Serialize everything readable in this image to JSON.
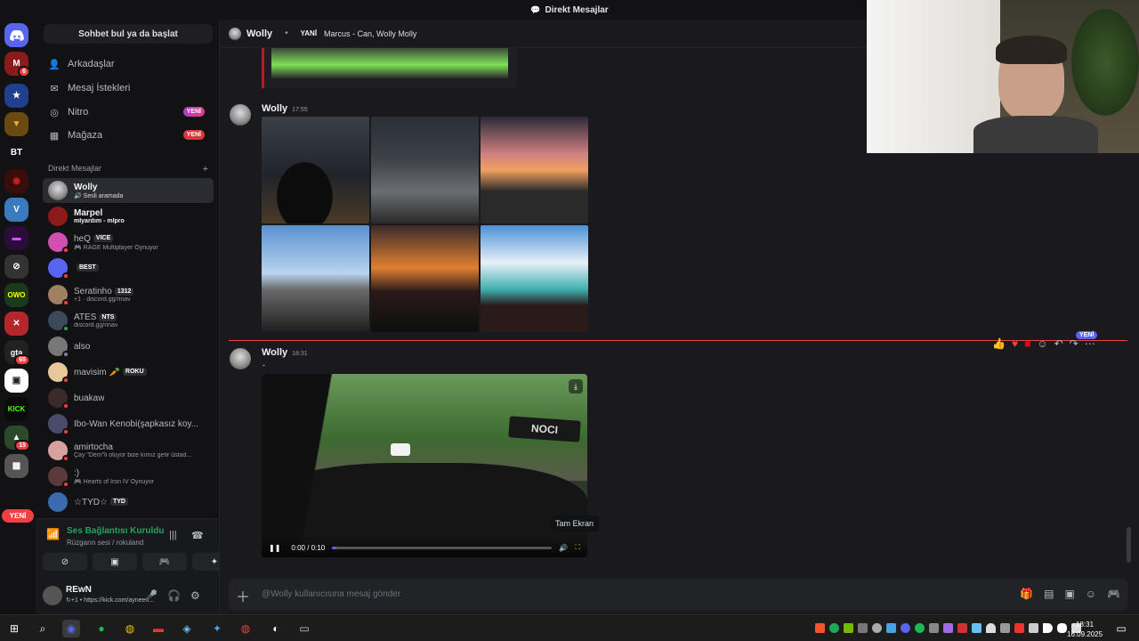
{
  "window": {
    "title": "Direkt Mesajlar"
  },
  "sidebar": {
    "search": "Sohbet bul ya da başlat",
    "nav": [
      {
        "label": "Arkadaşlar",
        "badge": ""
      },
      {
        "label": "Mesaj İstekleri",
        "badge": ""
      },
      {
        "label": "Nitro",
        "badge": "YENİ"
      },
      {
        "label": "Mağaza",
        "badge": "YENİ"
      }
    ],
    "dm_header": "Direkt Mesajlar",
    "dm_add": "+",
    "dms": [
      {
        "name": "Wolly",
        "sub": "Sesli aramada",
        "tag": ""
      },
      {
        "name": "Marpel",
        "sub": "mİyardım - mİpro",
        "tag": ""
      },
      {
        "name": "heQ",
        "sub": "RAGE Multiplayer Oynuyor",
        "tag": "VICE"
      },
      {
        "name": "",
        "sub": "",
        "tag": "BEST"
      },
      {
        "name": "Seratinho",
        "sub": "+1 · discord.gg/rinav",
        "tag": "1312"
      },
      {
        "name": "ATES",
        "sub": "discord.gg/rinav",
        "tag": "NTS"
      },
      {
        "name": "also",
        "sub": "",
        "tag": ""
      },
      {
        "name": "mavisim 🥕",
        "sub": "",
        "tag": "ROKU"
      },
      {
        "name": "buakaw",
        "sub": "",
        "tag": ""
      },
      {
        "name": "Ibo-Wan Kenobi(şapkasız koy...",
        "sub": "",
        "tag": ""
      },
      {
        "name": "amirtocha",
        "sub": "Çay \"Dem\"li oluyor bize kımız getir üstad...",
        "tag": ""
      },
      {
        "name": ":)",
        "sub": "Hearts of Iron IV Oynuyor",
        "tag": ""
      },
      {
        "name": "☆TYD☆",
        "sub": "",
        "tag": "TYD"
      }
    ]
  },
  "servers": {
    "items": [
      "M",
      "★",
      "▼",
      "BT",
      "◉",
      "V",
      "▬",
      "◯",
      "OWO",
      "✕",
      "gta",
      "▣",
      "KICK",
      "▲",
      "▦"
    ],
    "badges": {
      "m": "6",
      "gta": "65",
      "kick": "15"
    },
    "new_label": "YENİ"
  },
  "voice": {
    "title": "Ses Bağlantısı Kuruldu",
    "subtitle": "Rüzgarın sesi / rokuland"
  },
  "user": {
    "name": "REwN",
    "status": "↻+1 • https://kick.com/ayneen..."
  },
  "channel": {
    "name": "Wolly",
    "group_label": "YANİ",
    "group_members": "Marcus - Can, Wolly Molly"
  },
  "messages": [
    {
      "author": "Wolly",
      "time": "17:55"
    },
    {
      "author": "Wolly",
      "time": "18:31",
      "text": "-"
    }
  ],
  "video": {
    "time": "0:00 / 0:10",
    "progress": 0.0,
    "sticker": "NOCI",
    "tooltip": "Tam Ekran"
  },
  "new_badge": "YENİ",
  "input": {
    "placeholder": "@Wolly kullanıcısına mesaj gönder"
  },
  "taskbar": {
    "time": "18:31",
    "date": "16.09.2025"
  },
  "colors": {
    "accent": "#5865f2",
    "danger": "#f23f43",
    "online": "#23a55a",
    "nitro": "#b03bd0"
  }
}
